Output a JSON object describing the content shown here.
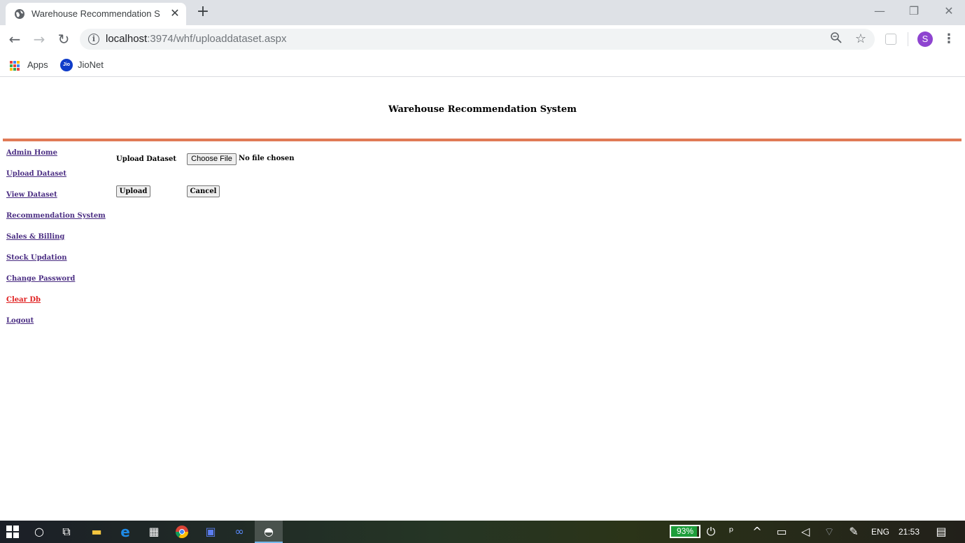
{
  "browser": {
    "tab": {
      "title": "Warehouse Recommendation System"
    },
    "newtab_symbol": "+",
    "url": {
      "host": "localhost",
      "path": ":3974/whf/uploaddataset.aspx"
    },
    "bookmarks": [
      {
        "label": "Apps"
      },
      {
        "label": "JioNet"
      }
    ],
    "profile_initial": "S",
    "jio_icon_text": "Jio"
  },
  "page": {
    "title": "Warehouse Recommendation System",
    "accent_color": "#e07a56",
    "sidenav": [
      {
        "label": "Admin Home",
        "color": "#4b2e83"
      },
      {
        "label": "Upload Dataset",
        "color": "#4b2e83"
      },
      {
        "label": "View Dataset",
        "color": "#4b2e83"
      },
      {
        "label": "Recommendation System",
        "color": "#4b2e83"
      },
      {
        "label": "Sales & Billing",
        "color": "#4b2e83"
      },
      {
        "label": "Stock Updation",
        "color": "#4b2e83"
      },
      {
        "label": "Change Password",
        "color": "#4b2e83"
      },
      {
        "label": "Clear Db",
        "color": "#e02020"
      },
      {
        "label": "Logout",
        "color": "#4b2e83"
      }
    ],
    "form": {
      "upload_label": "Upload Dataset",
      "choose_file_label": "Choose File",
      "no_file_text": "No file chosen",
      "upload_button": "Upload",
      "cancel_button": "Cancel"
    }
  },
  "taskbar": {
    "battery_percent": "93%",
    "battery_level": 0.93,
    "language": "ENG",
    "time": "21:53"
  }
}
